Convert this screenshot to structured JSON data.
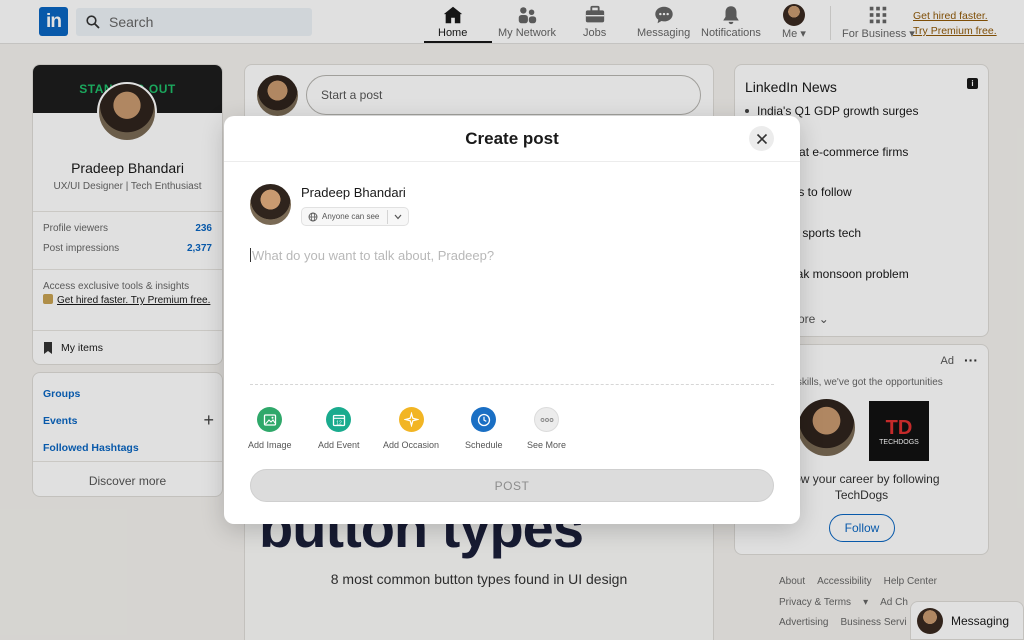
{
  "nav": {
    "logo": "in",
    "search_placeholder": "Search",
    "items": [
      {
        "label": "Home",
        "icon": "home-icon"
      },
      {
        "label": "My Network",
        "icon": "network-icon"
      },
      {
        "label": "Jobs",
        "icon": "briefcase-icon"
      },
      {
        "label": "Messaging",
        "icon": "messaging-icon"
      },
      {
        "label": "Notifications",
        "icon": "bell-icon"
      },
      {
        "label": "Me",
        "icon": "avatar"
      },
      {
        "label": "For Business",
        "icon": "grid-icon"
      }
    ],
    "premium_line1": "Get hired faster.",
    "premium_line2": "Try Premium free."
  },
  "profile": {
    "banner_text": "STANDING OUT",
    "name": "Pradeep Bhandari",
    "headline": "UX/UI Designer | Tech Enthusiast",
    "stats": [
      {
        "label": "Profile viewers",
        "value": "236"
      },
      {
        "label": "Post impressions",
        "value": "2,377"
      }
    ],
    "promo_text": "Access exclusive tools & insights",
    "promo_link": "Get hired faster. Try Premium free.",
    "my_items": "My items"
  },
  "groups": {
    "links": [
      "Groups",
      "Events",
      "Followed Hashtags"
    ],
    "discover": "Discover more"
  },
  "feed": {
    "share_placeholder": "Start a post",
    "post_title": "button types",
    "post_caption": "8 most common button types found in UI design"
  },
  "news": {
    "title": "LinkedIn News",
    "items": [
      "India's Q1 GDP growth surges",
      "women at e-commerce firms",
      "wsletters to follow",
      "s power sports tech",
      "ny's weak monsoon problem"
    ],
    "show_more": "ore"
  },
  "ad": {
    "label": "Ad",
    "tagline": "the skills, we've got the opportunities",
    "logo_text": "TECHDOGS",
    "line1": "grow your career by following",
    "line2": "TechDogs",
    "follow": "Follow"
  },
  "footer": {
    "row1": [
      "About",
      "Accessibility",
      "Help Center"
    ],
    "row2": [
      "Privacy & Terms",
      "Ad Ch"
    ],
    "row3": [
      "Advertising",
      "Business Servi"
    ]
  },
  "messaging_bar": "Messaging",
  "modal": {
    "title": "Create post",
    "author": "Pradeep Bhandari",
    "visibility": "Anyone can see",
    "placeholder": "What do you want to talk about, Pradeep?",
    "tools": [
      {
        "label": "Add Image",
        "color": "#2fa86a"
      },
      {
        "label": "Add Event",
        "color": "#1aab8e"
      },
      {
        "label": "Add Occasion",
        "color": "#f2b524"
      },
      {
        "label": "Schedule",
        "color": "#1a6fc4"
      },
      {
        "label": "See More",
        "color": "#ececec"
      }
    ],
    "post_button": "POST"
  }
}
